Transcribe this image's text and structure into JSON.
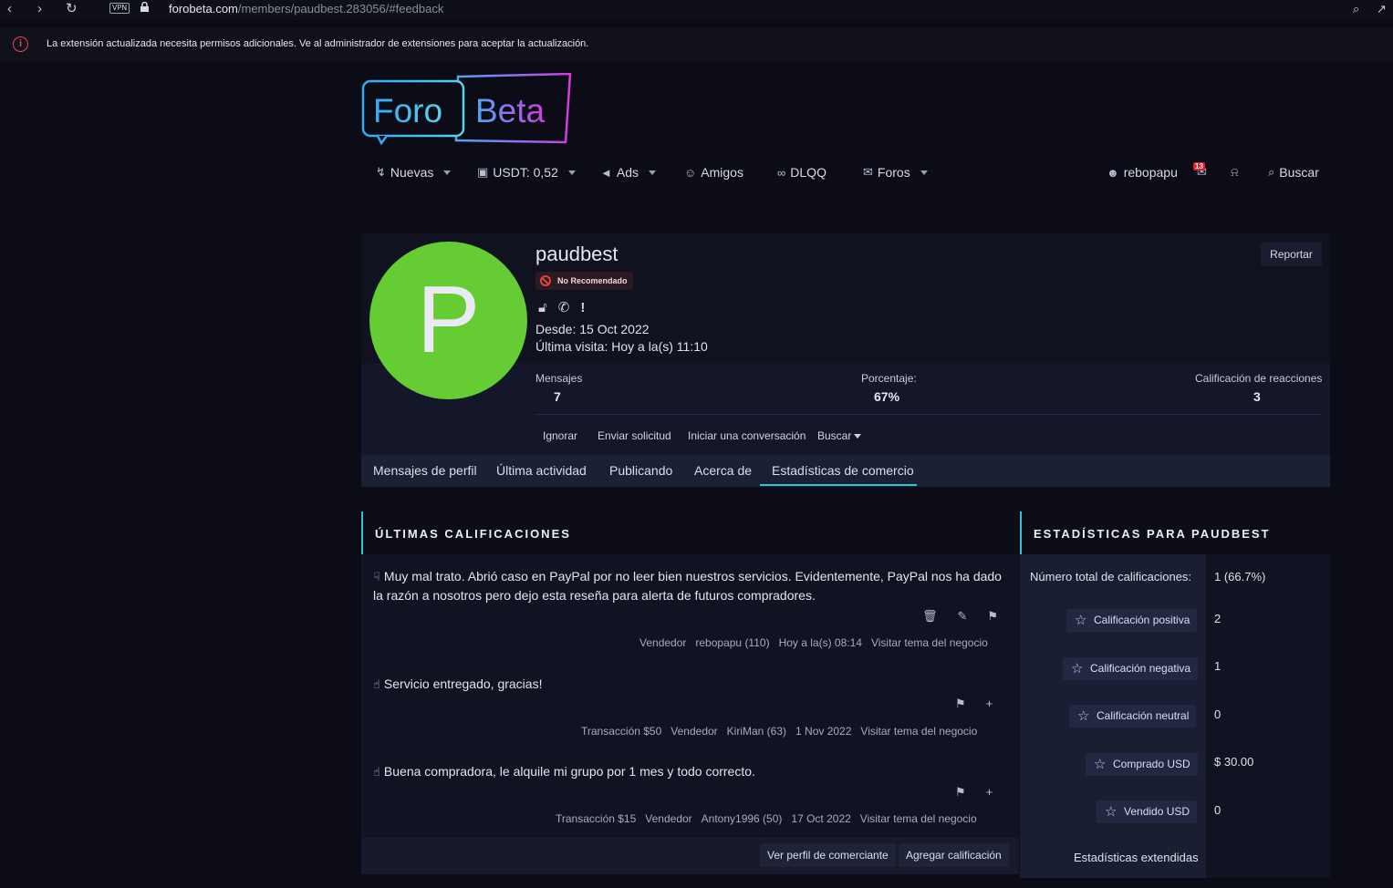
{
  "browser": {
    "vpn_label": "VPN",
    "url_domain": "forobeta.com",
    "url_path": "/members/paudbest.283056/#feedback"
  },
  "extension_warning": {
    "text": "La extensión actualizada necesita permisos adicionales. Ve al administrador de extensiones para aceptar la actualización."
  },
  "logo": {
    "part1": "Foro",
    "part2": "Beta"
  },
  "nav": {
    "items": [
      {
        "label": "Nuevas",
        "icon": "bolt-icon",
        "dropdown": true
      },
      {
        "label": "USDT: 0,52",
        "icon": "money-icon",
        "dropdown": true
      },
      {
        "label": "Ads",
        "icon": "megaphone-icon",
        "dropdown": true
      },
      {
        "label": "Amigos",
        "icon": "users-icon",
        "dropdown": false
      },
      {
        "label": "DLQQ",
        "icon": "binoculars-icon",
        "dropdown": false
      },
      {
        "label": "Foros",
        "icon": "comments-icon",
        "dropdown": true
      }
    ],
    "user": "rebopapu",
    "inbox_count": "13",
    "search_label": "Buscar"
  },
  "profile": {
    "avatar_letter": "P",
    "avatar_color": "#66cc33",
    "username": "paudbest",
    "badge": "No Recomendado",
    "since": "Desde: 15 Oct 2022",
    "last_visit": "Última visita: Hoy a la(s) 11:10",
    "report_label": "Reportar",
    "stats": [
      {
        "label": "Mensajes",
        "value": "7"
      },
      {
        "label": "Porcentaje:",
        "value": "67%"
      },
      {
        "label": "Calificación de reacciones",
        "value": "3"
      }
    ],
    "actions": [
      "Ignorar",
      "Enviar solicitud",
      "Iniciar una conversación",
      "Buscar"
    ],
    "tabs": [
      "Mensajes de perfil",
      "Última actividad",
      "Publicando",
      "Acerca de",
      "Estadísticas de comercio"
    ],
    "active_tab": "Estadísticas de comercio"
  },
  "ratings": {
    "title": "ÚLTIMAS CALIFICACIONES",
    "reviews": [
      {
        "type": "negative",
        "text": "Muy mal trato. Abrió caso en PayPal por no leer bien nuestros servicios. Evidentemente, PayPal nos ha dado la razón a nosotros pero dejo esta reseña para alerta de futuros compradores.",
        "meta": [
          "Vendedor",
          "rebopapu (110)",
          "Hoy a la(s) 08:14",
          "Visitar tema del negocio"
        ]
      },
      {
        "type": "positive",
        "text": "Servicio entregado, gracias!",
        "meta": [
          "Transacción $50",
          "Vendedor",
          "KiriMan (63)",
          "1 Nov 2022",
          "Visitar tema del negocio"
        ]
      },
      {
        "type": "positive",
        "text": "Buena compradora, le alquile mi grupo por 1 mes y todo correcto.",
        "meta": [
          "Transacción $15",
          "Vendedor",
          "Antony1996 (50)",
          "17 Oct 2022",
          "Visitar tema del negocio"
        ]
      }
    ],
    "footer_buttons": [
      "Ver perfil de comerciante",
      "Agregar calificación"
    ]
  },
  "stats_panel": {
    "title": "ESTADÍSTICAS PARA PAUDBEST",
    "total_label": "Número total de calificaciones:",
    "total_value": "1 (66.7%)",
    "rows": [
      {
        "label": "Calificación positiva",
        "value": "2"
      },
      {
        "label": "Calificación negativa",
        "value": "1"
      },
      {
        "label": "Calificación neutral",
        "value": "0"
      },
      {
        "label": "Comprado USD",
        "value": "$ 30.00"
      },
      {
        "label": "Vendido USD",
        "value": "0"
      }
    ],
    "extended_label": "Estadísticas extendidas"
  }
}
